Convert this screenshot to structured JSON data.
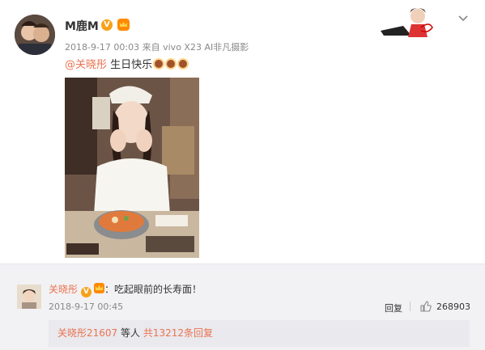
{
  "post": {
    "username": "M鹿M",
    "verified_badge": "V",
    "meta": "2018-9-17 00:03 来自 vivo X23 AI非凡摄影",
    "mention": "@关晓彤",
    "text": " 生日快乐",
    "icons": [
      "verified-icon",
      "vip-crown-icon",
      "cake-emoji",
      "chevron-down-icon"
    ]
  },
  "comment": {
    "username": "关晓彤",
    "verified_badge": "V",
    "text": "：吃起眼前的长寿面！",
    "time": "2018-9-17 00:45",
    "reply_label": "回复",
    "like_count": "268903"
  },
  "replies": {
    "users": "关晓彤21607",
    "suffix": " 等人 ",
    "link": "共13212条回复"
  },
  "colors": {
    "link": "#eb7350",
    "meta": "#888888",
    "comment_bg": "#f2f2f5",
    "badge": "#f7a11b"
  }
}
